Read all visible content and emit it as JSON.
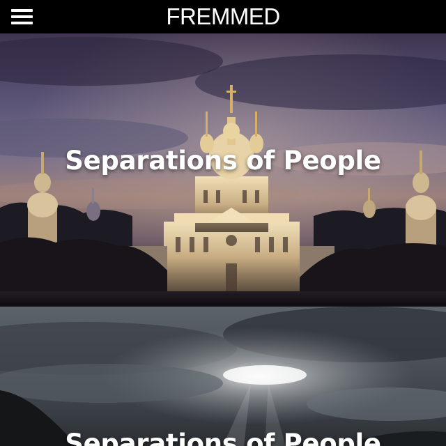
{
  "app": {
    "title": "FREMMED",
    "menu_icon": "hamburger-menu-icon"
  },
  "cards": [
    {
      "title": "Separations of People",
      "image": "baroque-cathedral-sunset-photo"
    },
    {
      "title": "Separations of People",
      "image": "cloudy-sky-sun-rays-photo"
    }
  ]
}
